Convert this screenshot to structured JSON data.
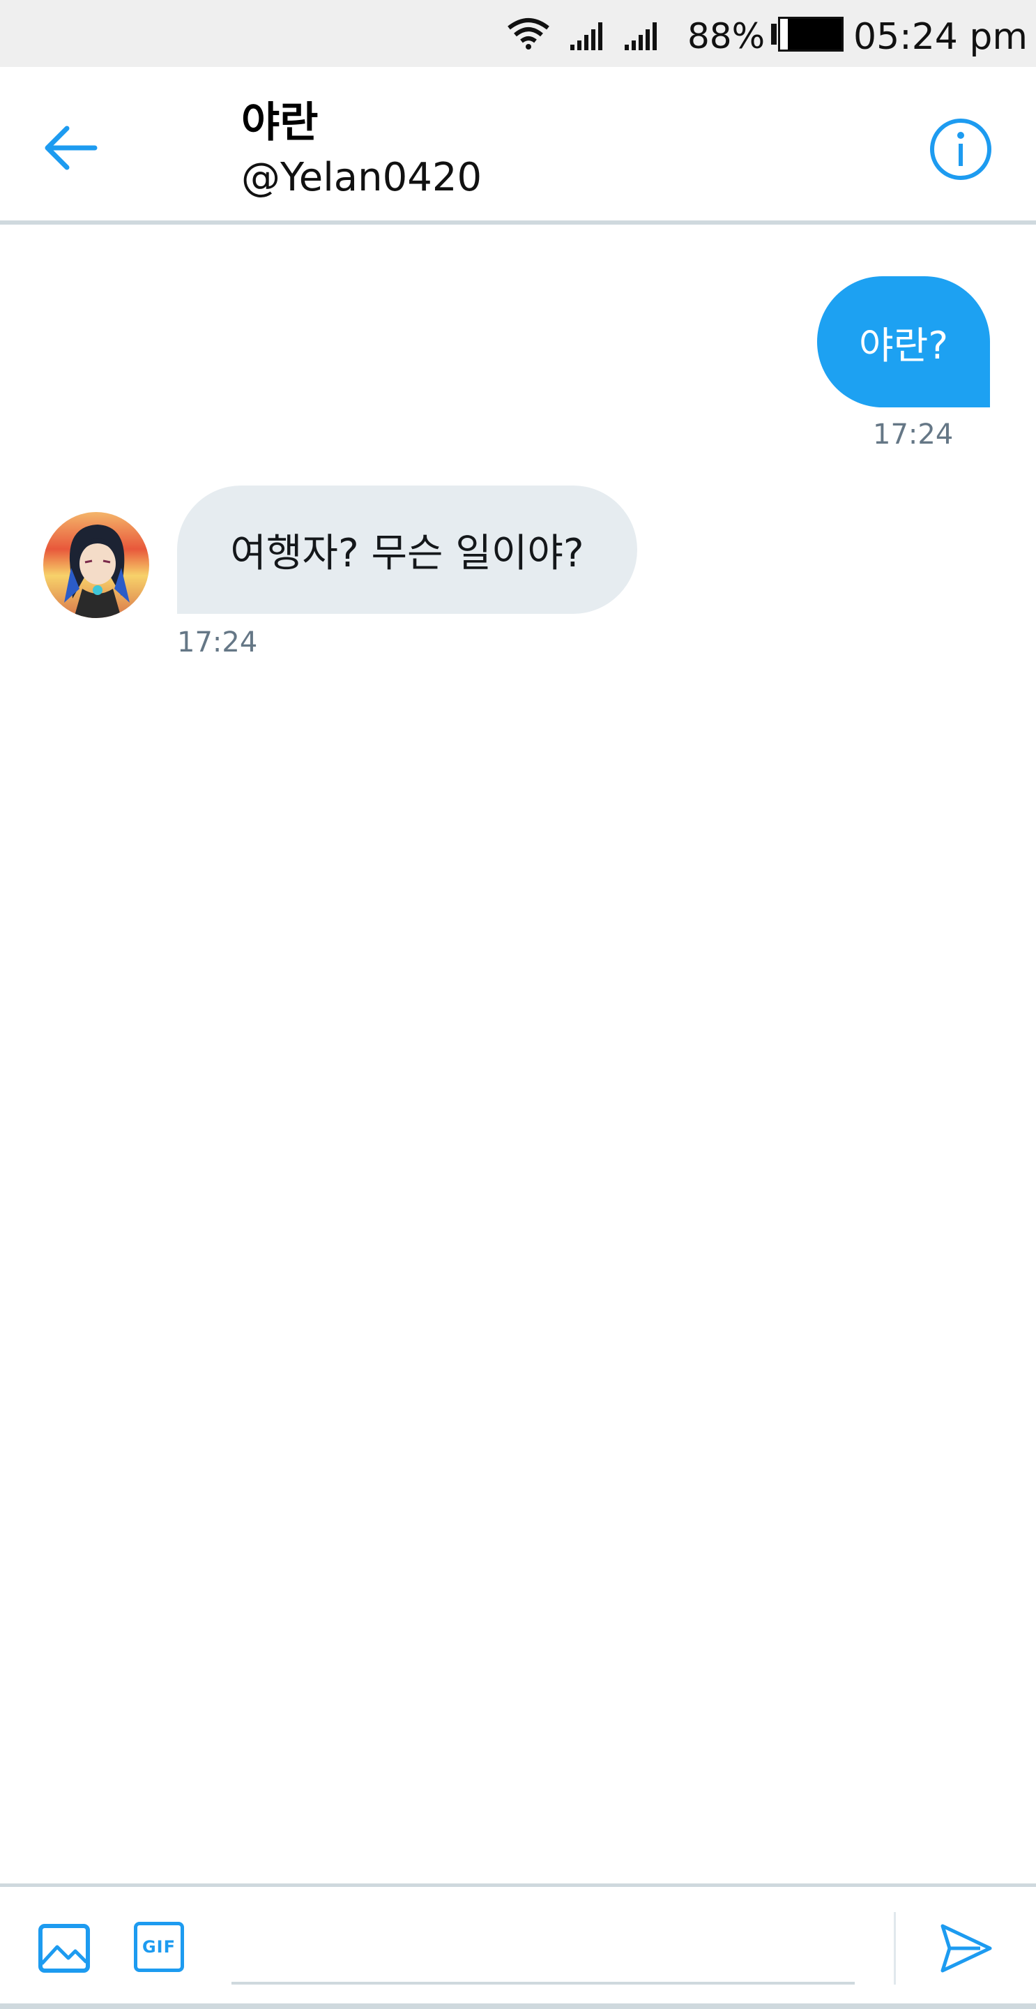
{
  "status_bar": {
    "battery_percent": "88%",
    "time": "05:24 pm",
    "icons": [
      "wifi-icon",
      "signal-icon",
      "signal-icon",
      "battery-icon"
    ]
  },
  "header": {
    "name": "야란",
    "handle": "@Yelan0420",
    "icons": [
      "back-arrow-icon",
      "info-icon"
    ]
  },
  "messages": [
    {
      "direction": "outgoing",
      "text": "야란?",
      "time": "17:24"
    },
    {
      "direction": "incoming",
      "text": "여행자? 무슨 일이야?",
      "time": "17:24"
    }
  ],
  "composer": {
    "placeholder": "",
    "gif_label": "GIF",
    "icons": [
      "image-icon",
      "gif-icon",
      "send-icon"
    ]
  },
  "colors": {
    "accent": "#1d9bf0",
    "outgoing_bubble": "#1da1f2",
    "incoming_bubble": "#e6ecf0",
    "status_bar_bg": "#efefef"
  }
}
